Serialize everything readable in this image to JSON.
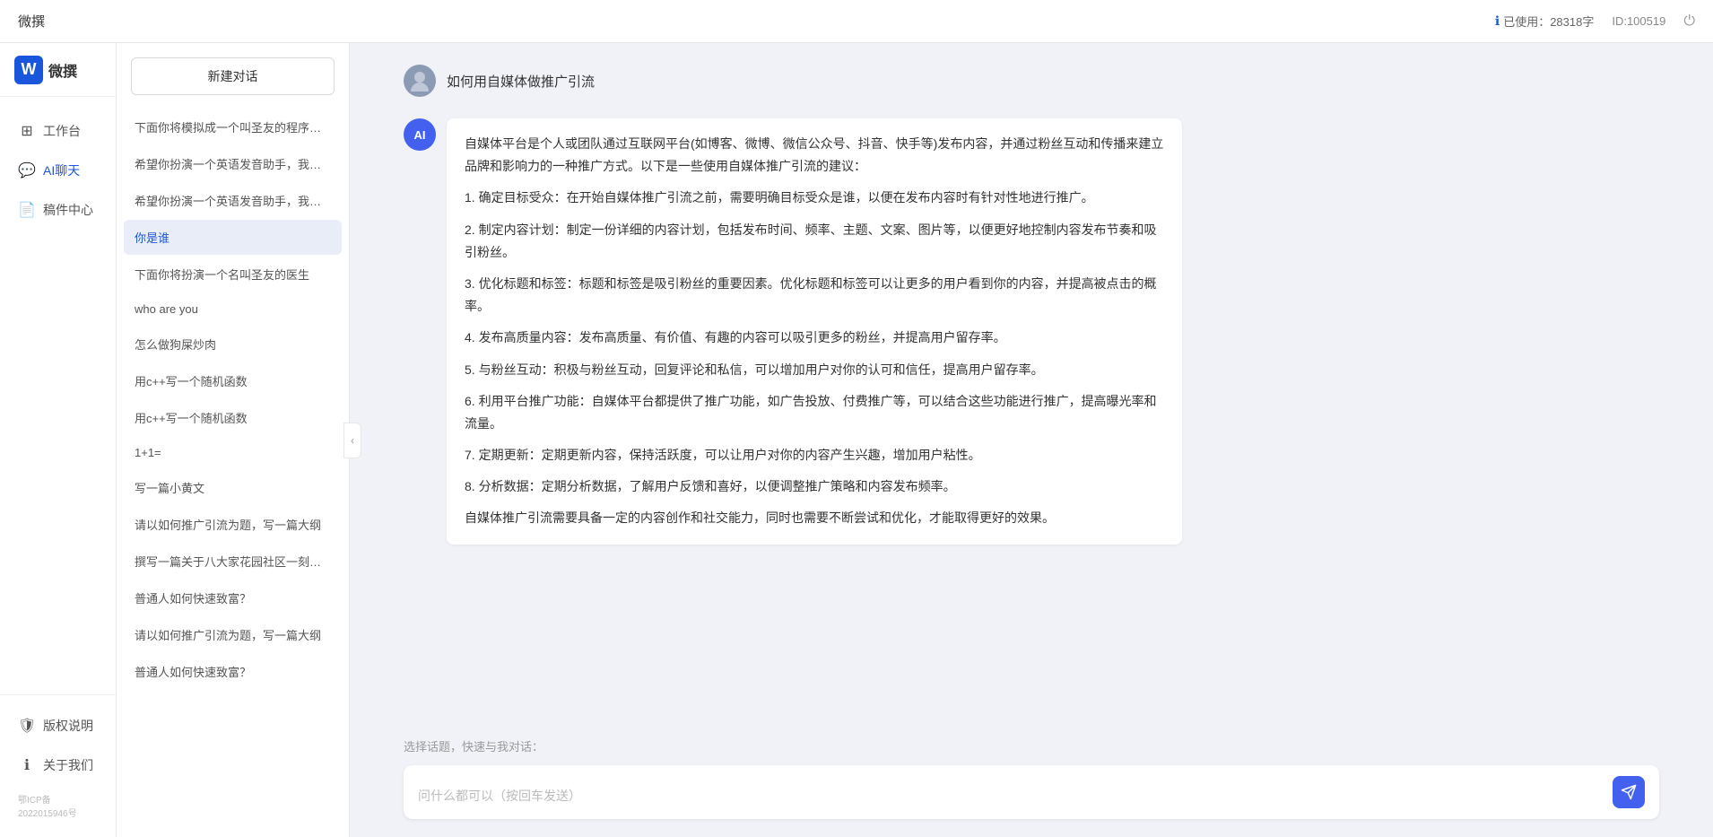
{
  "topbar": {
    "title": "微撰",
    "usage_icon": "info-icon",
    "usage_label": "已使用：28318字",
    "id_label": "ID:100519",
    "logout_icon": "power-icon"
  },
  "logo": {
    "letter": "W",
    "text": "微撰"
  },
  "nav": {
    "items": [
      {
        "id": "workbench",
        "icon": "grid-icon",
        "label": "工作台"
      },
      {
        "id": "ai-chat",
        "icon": "chat-icon",
        "label": "AI聊天"
      },
      {
        "id": "drafts",
        "icon": "file-icon",
        "label": "稿件中心"
      }
    ],
    "bottom_items": [
      {
        "id": "copyright",
        "icon": "shield-icon",
        "label": "版权说明"
      },
      {
        "id": "about",
        "icon": "info-circle-icon",
        "label": "关于我们"
      }
    ],
    "footer": "鄂ICP备2022015946号"
  },
  "conv_panel": {
    "new_conv_label": "新建对话",
    "conversations": [
      {
        "id": 1,
        "text": "下面你将模拟成一个叫圣友的程序员，我说..."
      },
      {
        "id": 2,
        "text": "希望你扮演一个英语发音助手，我提供给你..."
      },
      {
        "id": 3,
        "text": "希望你扮演一个英语发音助手，我提供给你..."
      },
      {
        "id": 4,
        "text": "你是谁",
        "active": true
      },
      {
        "id": 5,
        "text": "下面你将扮演一个名叫圣友的医生"
      },
      {
        "id": 6,
        "text": "who are you"
      },
      {
        "id": 7,
        "text": "怎么做狗屎炒肉"
      },
      {
        "id": 8,
        "text": "用c++写一个随机函数"
      },
      {
        "id": 9,
        "text": "用c++写一个随机函数"
      },
      {
        "id": 10,
        "text": "1+1="
      },
      {
        "id": 11,
        "text": "写一篇小黄文"
      },
      {
        "id": 12,
        "text": "请以如何推广引流为题，写一篇大纲"
      },
      {
        "id": 13,
        "text": "撰写一篇关于八大家花园社区一刻钟便民生..."
      },
      {
        "id": 14,
        "text": "普通人如何快速致富？"
      },
      {
        "id": 15,
        "text": "请以如何推广引流为题，写一篇大纲"
      },
      {
        "id": 16,
        "text": "普通人如何快速致富？"
      }
    ],
    "collapse_icon": "chevron-left-icon"
  },
  "chat": {
    "user_message": "如何用自媒体做推广引流",
    "ai_response": {
      "paragraphs": [
        "自媒体平台是个人或团队通过互联网平台(如博客、微博、微信公众号、抖音、快手等)发布内容，并通过粉丝互动和传播来建立品牌和影响力的一种推广方式。以下是一些使用自媒体推广引流的建议：",
        "1. 确定目标受众：在开始自媒体推广引流之前，需要明确目标受众是谁，以便在发布内容时有针对性地进行推广。",
        "2. 制定内容计划：制定一份详细的内容计划，包括发布时间、频率、主题、文案、图片等，以便更好地控制内容发布节奏和吸引粉丝。",
        "3. 优化标题和标签：标题和标签是吸引粉丝的重要因素。优化标题和标签可以让更多的用户看到你的内容，并提高被点击的概率。",
        "4. 发布高质量内容：发布高质量、有价值、有趣的内容可以吸引更多的粉丝，并提高用户留存率。",
        "5. 与粉丝互动：积极与粉丝互动，回复评论和私信，可以增加用户对你的认可和信任，提高用户留存率。",
        "6. 利用平台推广功能：自媒体平台都提供了推广功能，如广告投放、付费推广等，可以结合这些功能进行推广，提高曝光率和流量。",
        "7. 定期更新：定期更新内容，保持活跃度，可以让用户对你的内容产生兴趣，增加用户粘性。",
        "8. 分析数据：定期分析数据，了解用户反馈和喜好，以便调整推广策略和内容发布频率。",
        "自媒体推广引流需要具备一定的内容创作和社交能力，同时也需要不断尝试和优化，才能取得更好的效果。"
      ]
    },
    "quick_topics_label": "选择话题，快速与我对话：",
    "input_placeholder": "问什么都可以（按回车发送）",
    "send_icon": "send-icon"
  }
}
